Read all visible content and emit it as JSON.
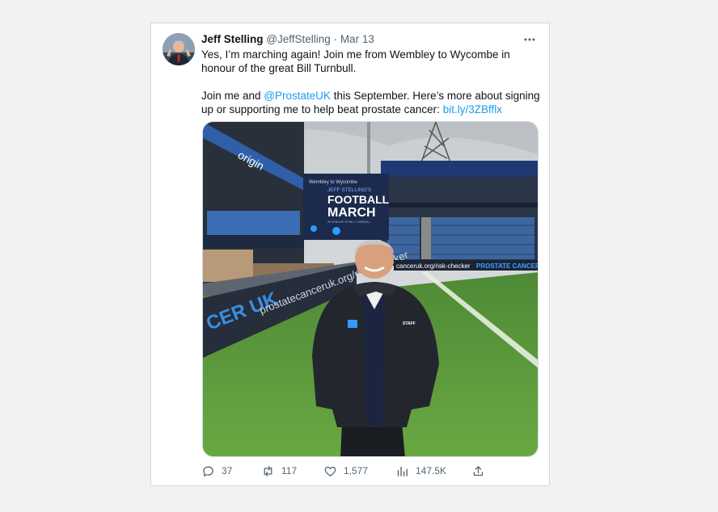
{
  "author": {
    "name": "Jeff Stelling",
    "handle": "@JeffStelling",
    "separator": "·",
    "date": "Mar 13"
  },
  "text": {
    "p1": "Yes, I’m marching again! Join me from Wembley to Wycombe in honour of the great Bill Turnbull.",
    "p2_before": "Join me and ",
    "p2_mention": "@ProstateUK",
    "p2_middle": " this September. Here’s more about signing up or supporting me to help beat prostate cancer: ",
    "p2_link": "bit.ly/3ZBfflx"
  },
  "media": {
    "sign_top": "JEFF STELLING'S",
    "sign_line1": "FOOTBALL",
    "sign_line2": "MARCH",
    "sign_sub": "Wembley to Wycombe",
    "sign_honour": "IN HONOUR OF BILL TURNBULL",
    "sponsor": "origin",
    "board_left": "CER UK",
    "board_url": "prostatecanceruk.org/risk-checker",
    "board_right_url": "canceruk.org/risk-checker",
    "board_right_name": "PROSTATE CANCER UK",
    "jacket_label": "STAFF"
  },
  "actions": {
    "replies": "37",
    "retweets": "117",
    "likes": "1,577",
    "views": "147.5K"
  },
  "colors": {
    "link": "#1d9bf0",
    "secondary_text": "#536471",
    "card_border": "#cfd9de"
  },
  "icons": [
    "more-icon",
    "reply-icon",
    "retweet-icon",
    "like-icon",
    "views-icon",
    "share-icon"
  ]
}
